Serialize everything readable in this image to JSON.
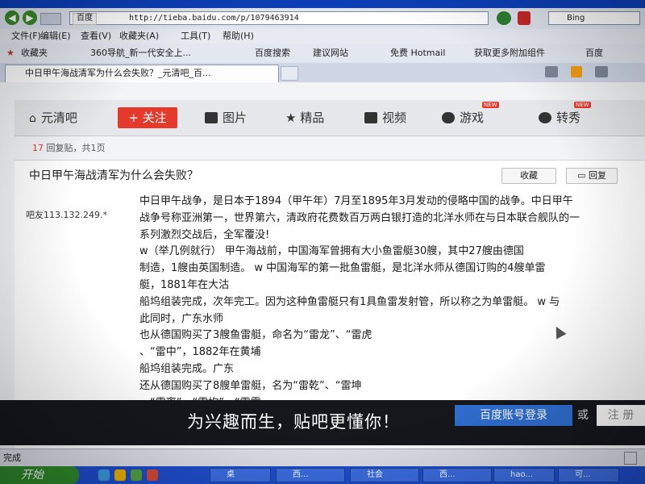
{
  "browser": {
    "title": "",
    "url_engine": "百度",
    "url": "http://tieba.baidu.com/p/1079463914",
    "search_box": "Bing",
    "menu": [
      "文件(F)",
      "编辑(E)",
      "查看(V)",
      "收藏夹(A)",
      "工具(T)",
      "帮助(H)"
    ],
    "favorites_label": "收藏夹",
    "favorites": [
      "360导航_新一代安全上...",
      "百度搜索",
      "建议网站",
      "免费 Hotmail",
      "获取更多附加组件",
      "百度"
    ],
    "active_tab": "中日甲午海战清军为什么会失败？_元清吧_百..."
  },
  "forum": {
    "name": "元清吧",
    "follow": "+ 关注",
    "nav": [
      "图片",
      "精品",
      "视频",
      "游戏",
      "转秀"
    ],
    "badge": "NEW",
    "reply_number": "17",
    "reply_text": "回复贴，共1页",
    "thread_title": "中日甲午海战清军为什么会失败？",
    "collect": "收藏",
    "reply": "回复",
    "poster": "吧友113.132.249.*",
    "post_lines": [
      "中日甲午战争，是日本于1894（甲午年）7月至1895年3月发动的侵略中国的战争。中日甲午",
      "战争号称亚洲第一，世界第六，清政府花费数百万两白银打造的北洋水师在与日本联合舰队的一",
      "系列激烈交战后，全军覆没!",
      "w（举几例就行） 甲午海战前，中国海军曾拥有大小鱼雷艇30艘，其中27艘由德国",
      "制造，1艘由英国制造。 w      中国海军的第一批鱼雷艇，是北洋水师从德国订购的4艘单雷",
      "艇，1881年在大沽",
      "船坞组装完成，次年完工。因为这种鱼雷艇只有1具鱼雷发射管，所以称之为单雷艇。 w      与",
      "此同时，广东水师",
      "也从德国购买了3艘鱼雷艇，命名为“雷龙”、“雷虎",
      "、“雷中”，1882年在黄埔",
      "船坞组装完成。广东",
      "还从德国购买了8艘单雷艇，名为“雷乾”、“雷坤",
      "、“雷离”、“雷坎”、“雷震"
    ]
  },
  "banner": {
    "slogan": "为兴趣而生，贴吧更懂你！",
    "login": "百度账号登录",
    "or": "或",
    "register": "注 册"
  },
  "statusbar": {
    "text": "完成"
  },
  "taskbar": {
    "start": "开始",
    "tasks": [
      "桌",
      "西...",
      "社会",
      "西...",
      "hao...",
      "可..."
    ]
  }
}
